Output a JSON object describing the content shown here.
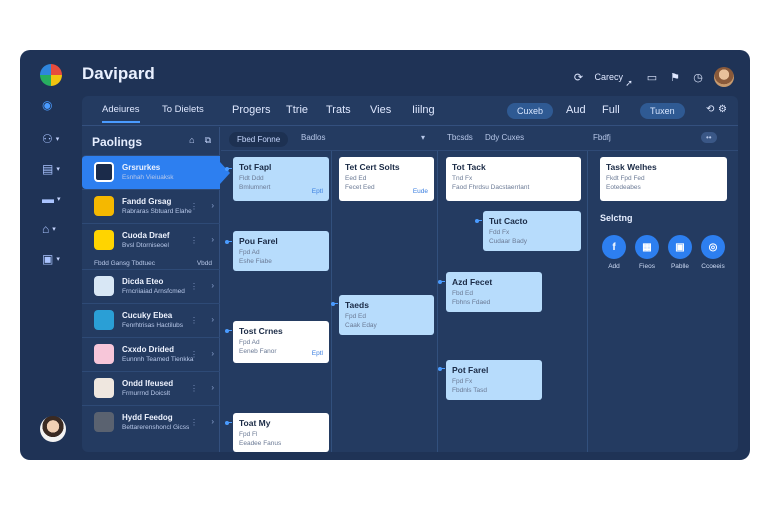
{
  "app": {
    "title": "Davipard"
  },
  "top_right": {
    "status_text": "Carecy"
  },
  "tabs": {
    "sidebar_tabs": [
      "Adeiures",
      "To Dielets"
    ],
    "main": [
      "Progers",
      "Ttrie",
      "Trats",
      "Vies",
      "Iiilng"
    ],
    "chip_left": "Cuxeb",
    "and_label": "Aud",
    "full_label": "Full",
    "chip_right": "Tuxen"
  },
  "sidebar": {
    "heading": "Paolings",
    "rows": [
      {
        "name": "Grsrurkes",
        "sub": "Esnhah Vieiuaksk",
        "thumb": "#1b2b4a"
      },
      {
        "name": "Fandd Grsag",
        "sub": "Rabraras Sbtuard Elahe",
        "thumb": "#f5b800"
      },
      {
        "name": "Cuoda Draef",
        "sub": "Bvsl Dtorniseoel",
        "thumb": "#ffd400"
      },
      {
        "name": "Dicda Eteo",
        "sub": "Frncriiaiad Arnsfcmed",
        "thumb": "#d8e7f5"
      },
      {
        "name": "Cucuky Ebea",
        "sub": "Fenrhtrisas Hactilubs",
        "thumb": "#2a9fd6"
      },
      {
        "name": "Cxxdo Drided",
        "sub": "Eunnnh Teamed Tienkka",
        "thumb": "#f7c6d9"
      },
      {
        "name": "Ondd Ifeused",
        "sub": "Frmurrnd Doicslt",
        "thumb": "#efe7df"
      },
      {
        "name": "Hydd Feedog",
        "sub": "Bettarerenshoncl Gicss",
        "thumb": "#5a6270"
      }
    ],
    "divider_left": "Fbdd Gansg Tbdtuec",
    "divider_right": "Vbdd"
  },
  "board": {
    "filter_pill": "Fbed Fonne",
    "filter_text": "Badlos",
    "filter_mid_1": "Tbcsds",
    "filter_mid_2": "Ddy Cuxes",
    "filter_right": "Fbdfj",
    "cards": [
      {
        "title": "Tot Fapl",
        "sub": "Fldt Ddd",
        "sub2": "Bmlumnert",
        "tag": "Eptl",
        "style": "light"
      },
      {
        "title": "Pou Farel",
        "sub": "Fpd Ad",
        "sub2": "Eshe Fiabe",
        "tag": "",
        "style": "light"
      },
      {
        "title": "Tost Crnes",
        "sub": "Fpd Ad",
        "sub2": "Eeneb Fanor",
        "tag": "Eptl",
        "style": "white"
      },
      {
        "title": "Toat My",
        "sub": "Fpd Fl",
        "sub2": "Eeadee Fanus",
        "tag": "",
        "style": "white"
      },
      {
        "title": "Tet Cert Solts",
        "sub": "Eed Ed",
        "sub2": "Fecet Eed",
        "tag": "Eude",
        "style": "white"
      },
      {
        "title": "Taeds",
        "sub": "Fpd Ed",
        "sub2": "Caak Eday",
        "tag": "",
        "style": "light"
      },
      {
        "title": "Tot Tack",
        "sub": "Tnd Fx",
        "sub2": "Faod Fhrdsu Dacstaerrlant",
        "tag": "",
        "style": "white"
      },
      {
        "title": "Tut Cacto",
        "sub": "Fdd Fx",
        "sub2": "Cudaar Bady",
        "tag": "",
        "style": "light"
      },
      {
        "title": "Azd Fecet",
        "sub": "Fbd Ed",
        "sub2": "Fbhns Fdaed",
        "tag": "",
        "style": "light"
      },
      {
        "title": "Pot Farel",
        "sub": "Fpd Fx",
        "sub2": "Fbdnls Tasd",
        "tag": "",
        "style": "light"
      },
      {
        "title": "Task Welhes",
        "sub": "Fkdt Fpd Fed",
        "sub2": "Eotedeabes",
        "tag": "",
        "style": "white"
      }
    ]
  },
  "actions": {
    "title": "Selctng",
    "items": [
      {
        "label": "Add",
        "glyph": "f"
      },
      {
        "label": "Fieos",
        "glyph": "▦"
      },
      {
        "label": "Pablle",
        "glyph": "▣"
      },
      {
        "label": "Ccoeeis",
        "glyph": "◎"
      }
    ]
  },
  "colors": {
    "accent": "#2d7ff0",
    "window": "#1f3356",
    "panel": "#243b61",
    "card_light": "#b7dcfc"
  }
}
